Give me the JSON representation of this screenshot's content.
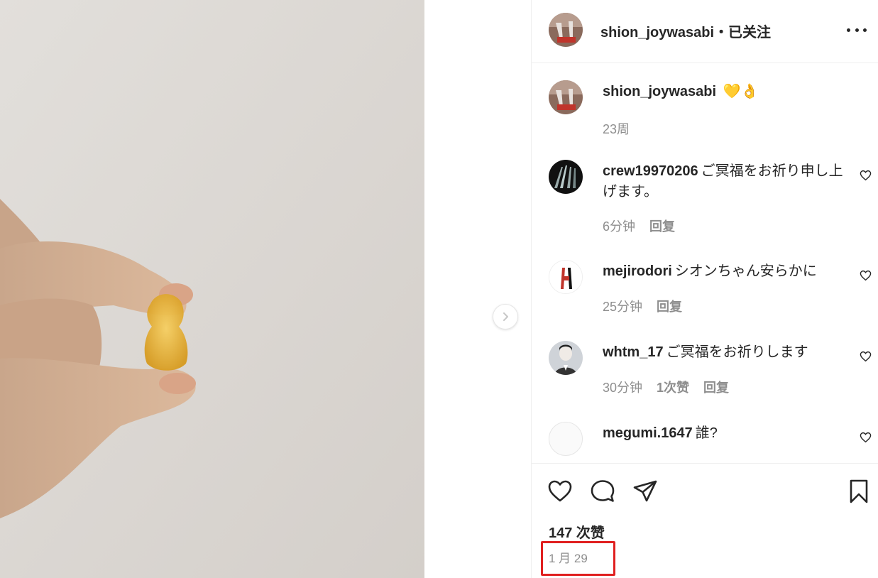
{
  "post": {
    "author": "shion_joywasabi",
    "follow_status": "・已关注"
  },
  "caption": {
    "username": "shion_joywasabi",
    "emoji_text": "💛👌",
    "time": "23周"
  },
  "comments": [
    {
      "username": "crew19970206",
      "text": "ご冥福をお祈り申し上げます。",
      "time": "6分钟",
      "likes": "",
      "reply": "回复"
    },
    {
      "username": "mejirodori",
      "text": "シオンちゃん安らかに",
      "time": "25分钟",
      "likes": "",
      "reply": "回复"
    },
    {
      "username": "whtm_17",
      "text": "ご冥福をお祈りします",
      "time": "30分钟",
      "likes": "1次赞",
      "reply": "回复"
    },
    {
      "username": "megumi.1647",
      "text": "誰?",
      "time": "",
      "likes": "",
      "reply": ""
    }
  ],
  "footer": {
    "likes_count": "147 次赞",
    "date": "1 月 29"
  },
  "icons": {
    "more": "more-options-icon",
    "like": "heart-icon",
    "comment": "comment-bubble-icon",
    "share": "paper-plane-icon",
    "save": "bookmark-icon",
    "next": "chevron-right-icon"
  },
  "colors": {
    "text": "#262626",
    "secondary": "#8e8e8e",
    "divider": "#efefef",
    "highlight_box": "#e02020"
  }
}
